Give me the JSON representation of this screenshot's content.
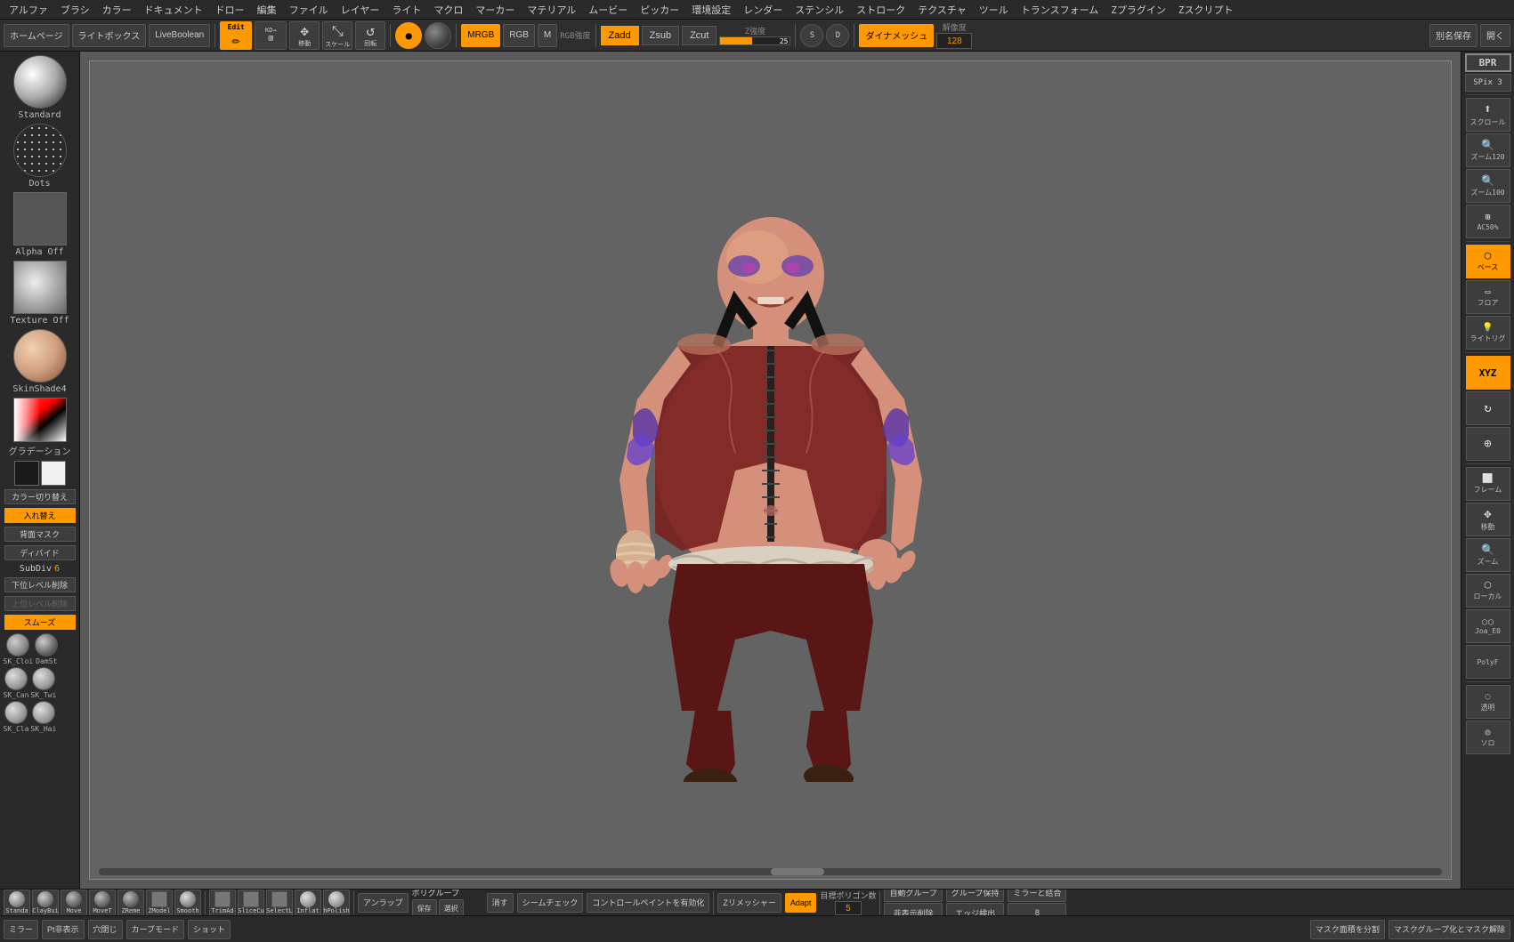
{
  "menus": {
    "items": [
      "アルファ",
      "ブラシ",
      "カラー",
      "ドキュメント",
      "ドロー",
      "編集",
      "ファイル",
      "レイヤー",
      "ライト",
      "マクロ",
      "マーカー",
      "マテリアル",
      "ムービー",
      "ピッカー",
      "環境設定",
      "レンダー",
      "ステンシル",
      "ストローク",
      "テクスチャ",
      "ツール",
      "トランスフォーム",
      "Zプラグイン",
      "Zスクリプト"
    ]
  },
  "toolbar": {
    "homepage": "ホームページ",
    "lightbox": "ライトボックス",
    "liveboolean": "LiveBoolean",
    "edit": "Edit",
    "move": "移動",
    "scale": "スケール",
    "rotate": "回転",
    "mrgb": "MRGB",
    "rgb": "RGB",
    "m": "M",
    "rgb_intensity": "RGB強度",
    "zadd": "Zadd",
    "zsub": "Zsub",
    "zcut": "Zcut",
    "z_intensity_label": "Z強度",
    "z_intensity": "25",
    "dynamesh": "ダイナメッシュ",
    "resolution_label": "解像度",
    "resolution": "128",
    "save_as": "別名保存",
    "open": "開く"
  },
  "left_panel": {
    "brush_label": "Standard",
    "dots_label": "Dots",
    "alpha_label": "Alpha Off",
    "texture_label": "Texture Off",
    "material_label": "SkinShade4",
    "gradient_label": "グラデーション",
    "color_switch": "カラー切り替え",
    "swap_label": "入れ替え",
    "back_mask": "背面マスク",
    "divide": "ディバイド",
    "subdiv_label": "SubDiv",
    "subdiv_value": "6",
    "delete_lower": "下位レベル削除",
    "delete_upper": "上位レベル削除",
    "smooth": "スムーズ",
    "brushes": [
      "SK_Cloi",
      "DamSt",
      "SK_Can",
      "SK_Twi",
      "SK_Cla",
      "SK_Hai"
    ]
  },
  "right_panel": {
    "bpr": "BPR",
    "spix3": "SPix 3",
    "scroll": "スクロール",
    "zoom120": "ズーム120",
    "zoom100": "ズーム100",
    "ac50": "AC50%",
    "base_active": "ベース",
    "floor": "フロア",
    "light_rig": "ライトリグ",
    "xyz": "XYZ",
    "rotate_icon": "⟳",
    "frame": "フレーム",
    "move_icon": "移動",
    "zoom_icon": "ズーム",
    "local": "ローカル",
    "joa_eo": "Joa_E0",
    "polyf": "PolyF",
    "transparent": "透明",
    "solo": "ソロ"
  },
  "bottom_bar": {
    "tools": [
      "Standa",
      "ClayBui",
      "Move",
      "MoveT",
      "ZReme",
      "ZModel",
      "Smooth",
      "TrimAd",
      "SliceCu",
      "SelectL",
      "Inflat",
      "hPolish"
    ],
    "unrap": "アンラップ",
    "polygroup": "ポリグループ",
    "save": "保存",
    "select": "選択",
    "delete": "消す",
    "seamcheck": "シームチェック",
    "control_paint": "コントロールペイントを有効化",
    "zremesher": "Zリメッシャー",
    "adapt": "Adapt",
    "target_poly_label": "目標ポリゴン数",
    "target_poly_value": "5",
    "auto_group": "自動グループ",
    "hide_delete": "非表示削除",
    "group_preserve": "グループ保持",
    "edge_detect": "エッジ検出",
    "mirror_merge": "ミラーと結合",
    "num8": "8"
  },
  "bottom_toolbar": {
    "mirror": "ミラー",
    "pt_display": "Pt非表示",
    "close_hole": "穴閉じ",
    "curve_mode": "カーブモード",
    "shot": "ショット",
    "mask_area": "マスク面積を分割",
    "mask_group": "マスクグループ化とマスク解除"
  },
  "colors": {
    "orange": "#ff9900",
    "dark_bg": "#2a2a2a",
    "panel_bg": "#3d3d3d",
    "viewport_bg": "#636363",
    "active_blue": "#4488cc"
  }
}
